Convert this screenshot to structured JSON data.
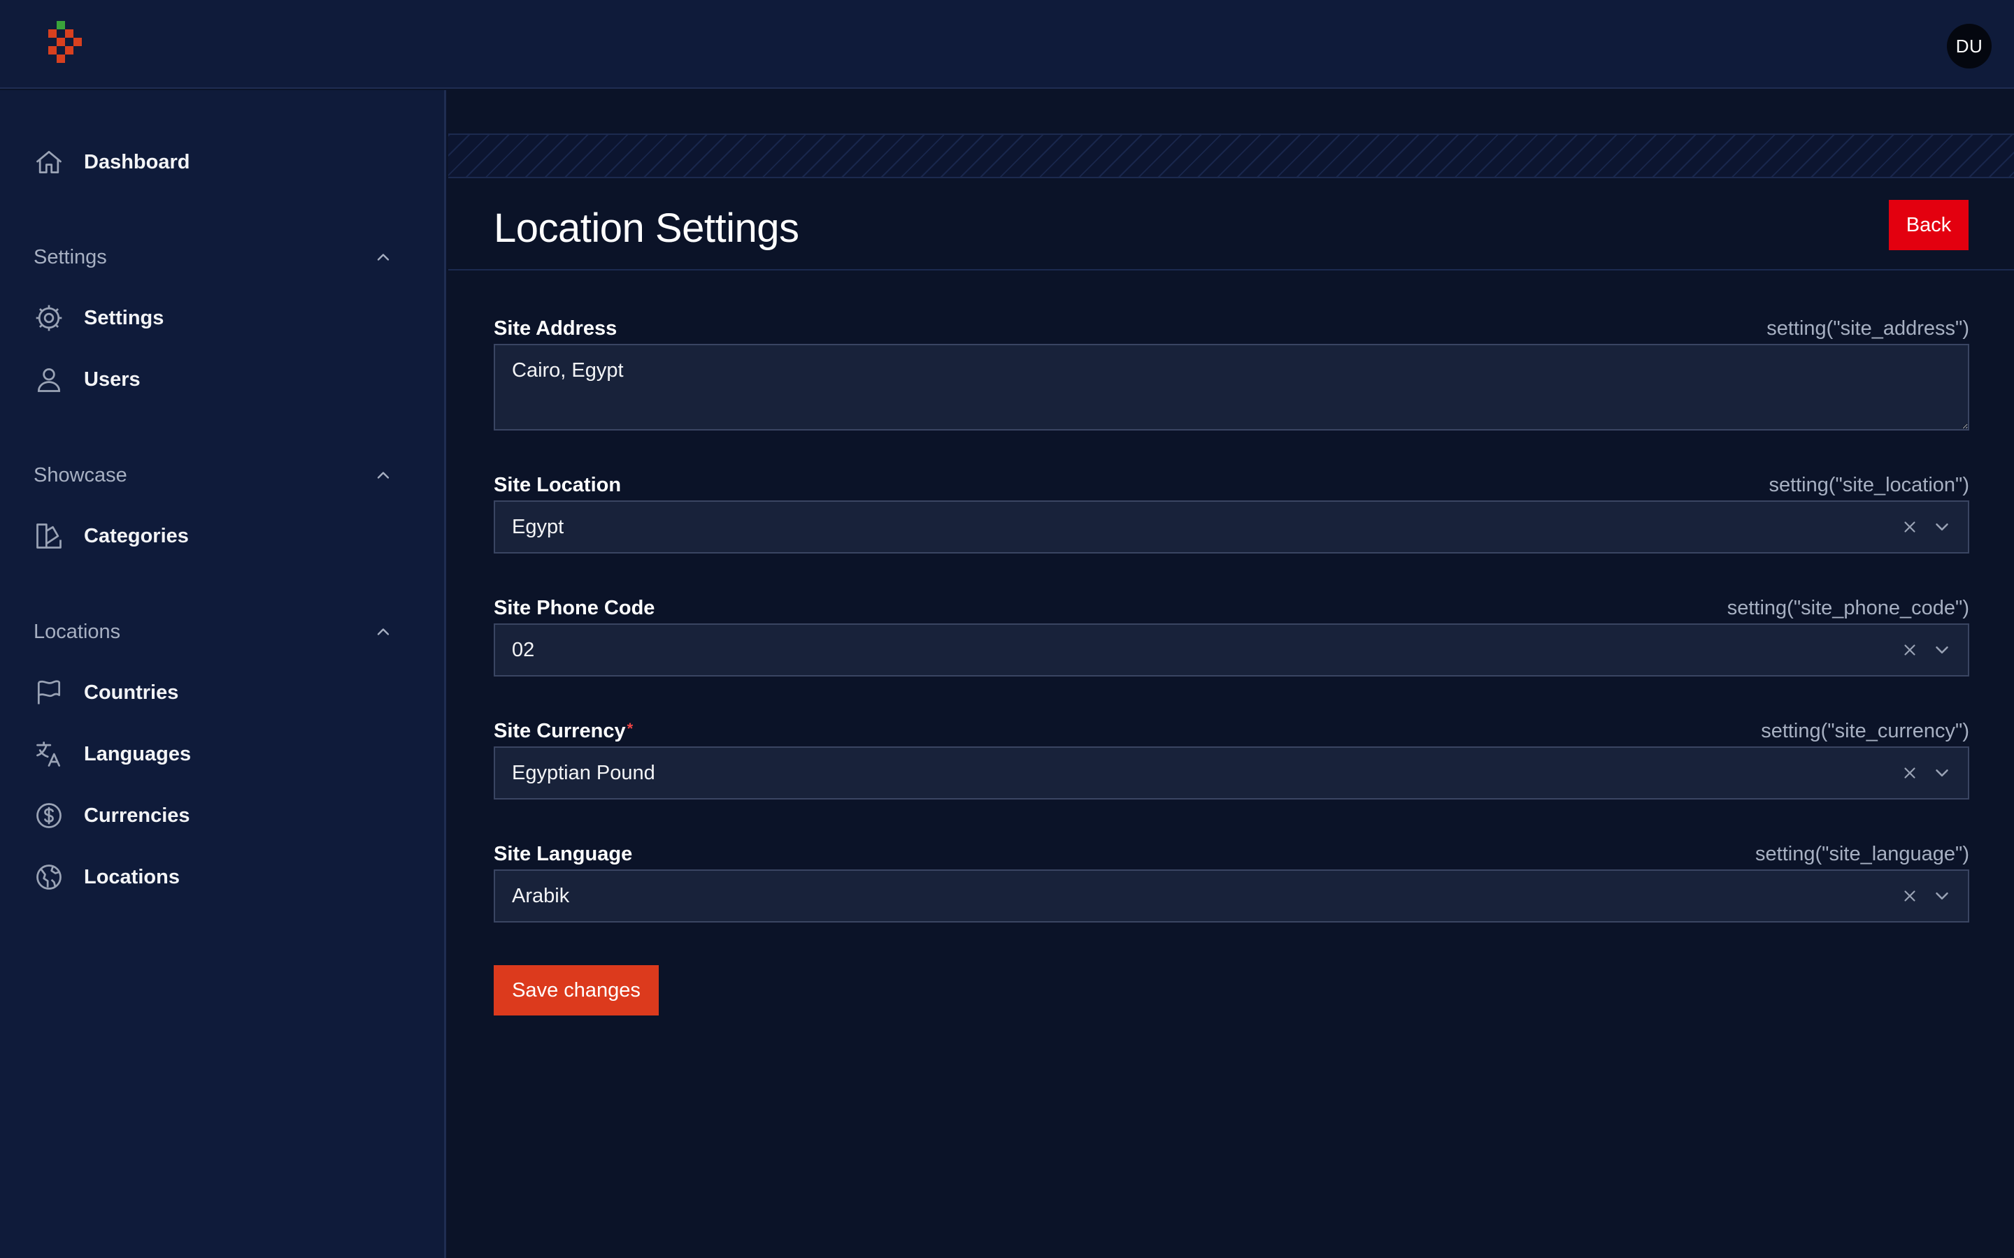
{
  "header": {
    "avatar_initials": "DU"
  },
  "colors": {
    "accent": "#dc3a1d",
    "back_button": "#e3000f",
    "logo_green": "#3aa33a",
    "logo_red": "#d8401f"
  },
  "sidebar": {
    "dashboard": {
      "label": "Dashboard",
      "icon": "home-icon"
    },
    "groups": [
      {
        "label": "Settings",
        "items": [
          {
            "label": "Settings",
            "icon": "gear-icon"
          },
          {
            "label": "Users",
            "icon": "user-icon"
          }
        ]
      },
      {
        "label": "Showcase",
        "items": [
          {
            "label": "Categories",
            "icon": "swatch-icon"
          }
        ]
      },
      {
        "label": "Locations",
        "items": [
          {
            "label": "Countries",
            "icon": "flag-icon"
          },
          {
            "label": "Languages",
            "icon": "translate-icon"
          },
          {
            "label": "Currencies",
            "icon": "dollar-icon"
          },
          {
            "label": "Locations",
            "icon": "globe-icon"
          }
        ]
      }
    ]
  },
  "page": {
    "title": "Location Settings",
    "back_label": "Back",
    "save_label": "Save changes",
    "fields": [
      {
        "label": "Site Address",
        "key": "setting(\"site_address\")",
        "value": "Cairo, Egypt",
        "type": "textarea"
      },
      {
        "label": "Site Location",
        "key": "setting(\"site_location\")",
        "value": "Egypt",
        "type": "select"
      },
      {
        "label": "Site Phone Code",
        "key": "setting(\"site_phone_code\")",
        "value": "02",
        "type": "select"
      },
      {
        "label": "Site Currency",
        "key": "setting(\"site_currency\")",
        "value": "Egyptian Pound",
        "type": "select",
        "required_mark": "*"
      },
      {
        "label": "Site Language",
        "key": "setting(\"site_language\")",
        "value": "Arabik",
        "type": "select"
      }
    ]
  }
}
